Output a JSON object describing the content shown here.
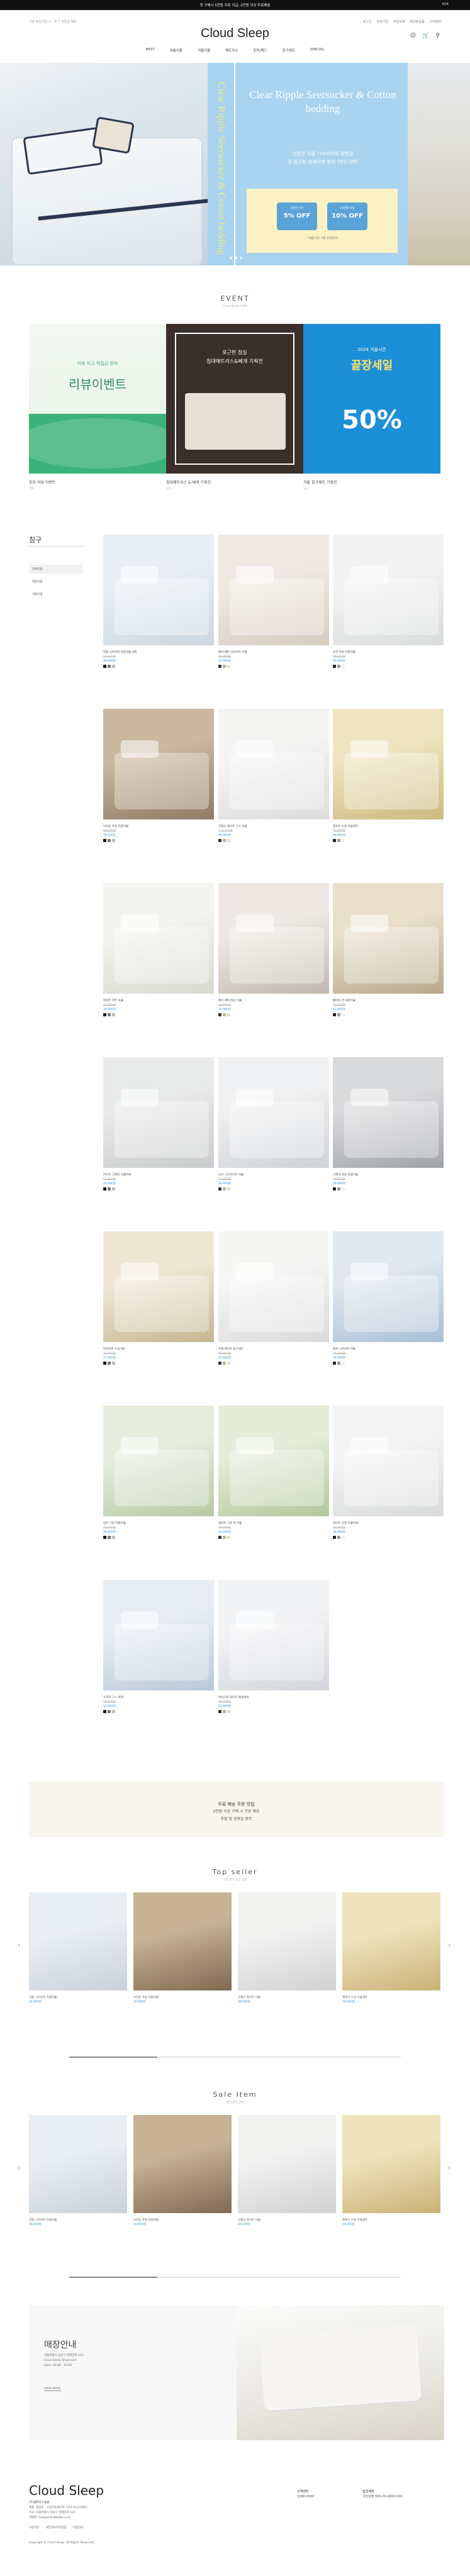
{
  "topbar": {
    "text": "첫 구매시 5천원 쿠폰 지급, 2만원 이상 무료배송",
    "lang": "KOR"
  },
  "util": {
    "left": "기본 회원가입 시 · 추가 적립금 혜택",
    "right": [
      "로그인",
      "회원가입",
      "주문조회",
      "최근본상품",
      "고객센터"
    ]
  },
  "brand": {
    "logo": "Cloud Sleep"
  },
  "nav": [
    "BEST",
    "여름이불",
    "겨울이불",
    "매트리스",
    "토퍼/패드",
    "침구세트",
    "SPECIAL"
  ],
  "hero": {
    "vertical": "Clear Ripple Seersucker & Cotton bedding",
    "title": "Clear Ripple Seersucker & Cotton bedding",
    "sub1": "산뜻한 리플 시어서커의 청량감",
    "sub2": "첫 침구와 함께라면 최대 70% OFF",
    "coupon1_label": "5만원 이상",
    "coupon1": "5% OFF",
    "coupon2_label": "10만원 이상",
    "coupon2": "10% OFF",
    "note": "* 적용기간: 7월 31일까지"
  },
  "event": {
    "title": "EVENT",
    "sub": "Cloud Sleep 이벤트",
    "items": [
      {
        "line1": "리뷰 쓰고 적립금 받자",
        "big": "리뷰이벤트",
        "caption": "포토 리뷰 이벤트",
        "date": "상시"
      },
      {
        "line1": "포근한 침실",
        "line2": "침대매트리스&베개 기획전",
        "caption": "침대매트리스 & 베개 기획전",
        "date": "상시"
      },
      {
        "line1": "2024 겨울시즌",
        "big": "끝장세일",
        "pct": "50%",
        "caption": "겨울 침구세트 기획전",
        "date": "상시"
      }
    ]
  },
  "category": {
    "title": "침구",
    "items": [
      "전체상품",
      "여름이불",
      "겨울이불"
    ]
  },
  "products": [
    {
      "name": "리플 시어서커 차렵이불 세트",
      "price": "59,900원",
      "sale": "39,900원"
    },
    {
      "name": "베어 패턴 시어서커 이불",
      "price": "49,900원",
      "sale": "35,900원"
    },
    {
      "name": "순면 워싱 차렵이불",
      "price": "69,900원",
      "sale": "45,900원"
    },
    {
      "name": "브라운 프릴 차렵이불",
      "price": "59,900원",
      "sale": "39,900원"
    },
    {
      "name": "호텔식 화이트 구스 이불",
      "price": "129,000원",
      "sale": "89,000원"
    },
    {
      "name": "옐로우 누빔 이불세트",
      "price": "59,900원",
      "sale": "39,900원"
    },
    {
      "name": "데일리 코튼 이불",
      "price": "49,900원",
      "sale": "34,900원"
    },
    {
      "name": "체크 패턴 워싱 이불",
      "price": "59,900원",
      "sale": "39,900원"
    },
    {
      "name": "베이지 면 차렵이불",
      "price": "59,900원",
      "sale": "42,900원"
    },
    {
      "name": "라이트 그레이 이불커버",
      "price": "45,900원",
      "sale": "32,900원"
    },
    {
      "name": "모던 스트라이프 이불",
      "price": "55,900원",
      "sale": "38,900원"
    },
    {
      "name": "그레이 워싱 차렵이불",
      "price": "59,900원",
      "sale": "39,900원"
    },
    {
      "name": "아이보리 누빔 패드",
      "price": "39,900원",
      "sale": "27,900원"
    },
    {
      "name": "호텔 화이트 침구세트",
      "price": "89,900원",
      "sale": "62,900원"
    },
    {
      "name": "블루 시어서커 이불",
      "price": "59,900원",
      "sale": "39,900원"
    },
    {
      "name": "민트 그린 차렵이불",
      "price": "55,900원",
      "sale": "38,900원"
    },
    {
      "name": "세이지 그린 면 이불",
      "price": "59,900원",
      "sale": "41,900원"
    },
    {
      "name": "화이트 순면 이불커버",
      "price": "49,900원",
      "sale": "34,900원"
    },
    {
      "name": "소프트 구스 베개",
      "price": "29,900원",
      "sale": "19,900원"
    },
    {
      "name": "마이크로 화이트 베개커버",
      "price": "19,900원",
      "sale": "12,900원"
    }
  ],
  "notice": {
    "line1": "무료 배송 주문 방법",
    "line2": "2만원 이상 구매 시 무료 배송",
    "line3": "주말 및 공휴일 휴무"
  },
  "top": {
    "title": "Top seller",
    "sub": "가장 인기 있는 상품"
  },
  "sale": {
    "title": "Sale Item",
    "sub": "세일 중인 상품"
  },
  "carousel": [
    {
      "name": "리플 시어서커 차렵이불",
      "sale": "39,900원"
    },
    {
      "name": "브라운 프릴 차렵이불",
      "sale": "39,900원"
    },
    {
      "name": "호텔식 화이트 이불",
      "sale": "89,000원"
    },
    {
      "name": "옐로우 누빔 이불세트",
      "sale": "39,900원"
    }
  ],
  "info": {
    "title": "매장안내",
    "l1": "서울특별시 강남구 테헤란로 123",
    "l2": "Cloud Sleep Showroom",
    "l3": "Open 10:00 - 19:00",
    "more": "VIEW MORE"
  },
  "footer": {
    "logo": "Cloud Sleep",
    "company": "(주)클라우드슬립",
    "lines": [
      "대표: 홍길동 · 사업자등록번호: 123-45-67890",
      "주소: 서울특별시 강남구 테헤란로 123",
      "이메일: help@cloudsleep.co.kr"
    ],
    "links": [
      "이용약관",
      "개인정보처리방침",
      "이용안내"
    ],
    "copyright": "Copyright © Cloud Sleep. All Rights Reserved.",
    "cs_title": "고객센터",
    "cs_tel": "1588-0000",
    "bank_title": "입금계좌",
    "bank": "국민은행 000-00-0000-000"
  }
}
